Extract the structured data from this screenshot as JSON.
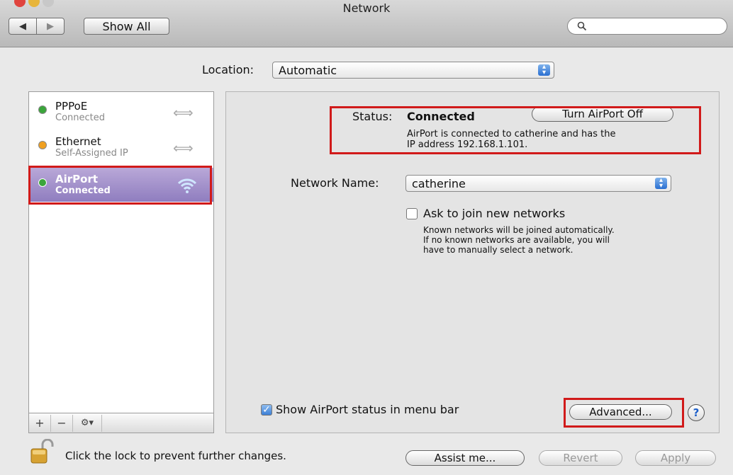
{
  "window": {
    "title": "Network"
  },
  "toolbar": {
    "back_icon": "back-arrow-icon",
    "forward_icon": "forward-arrow-icon",
    "show_all_label": "Show All",
    "search_icon": "magnifier-icon"
  },
  "location": {
    "label": "Location:",
    "value": "Automatic"
  },
  "services": [
    {
      "name": "PPPoE",
      "status": "Connected",
      "indicator": "#3aa53a",
      "icon": "arrows-icon"
    },
    {
      "name": "Ethernet",
      "status": "Self-Assigned IP",
      "indicator": "#f0a020",
      "icon": "arrows-icon"
    },
    {
      "name": "AirPort",
      "status": "Connected",
      "indicator": "#3aa53a",
      "icon": "wifi-icon"
    }
  ],
  "sidebar_footer": {
    "add": "+",
    "remove": "−",
    "actions": "⚙▾"
  },
  "status": {
    "label": "Status:",
    "value": "Connected",
    "toggle_label": "Turn AirPort Off",
    "description_line1": "AirPort is connected to catherine and has the",
    "description_line2": "IP address 192.168.1.101."
  },
  "network": {
    "label": "Network Name:",
    "value": "catherine"
  },
  "ask_join": {
    "label": "Ask to join new networks",
    "checked": false,
    "help_line1": "Known networks will be joined automatically.",
    "help_line2": "If no known networks are available, you will",
    "help_line3": "have to manually select a network."
  },
  "menu_bar": {
    "label": "Show AirPort status in menu bar",
    "checked": true
  },
  "buttons": {
    "advanced": "Advanced...",
    "help": "?",
    "assist": "Assist me...",
    "revert": "Revert",
    "apply": "Apply"
  },
  "lock": {
    "text": "Click the lock to prevent further changes."
  },
  "colors": {
    "highlight": "#d11a1a",
    "selection": "#9a89c6"
  }
}
